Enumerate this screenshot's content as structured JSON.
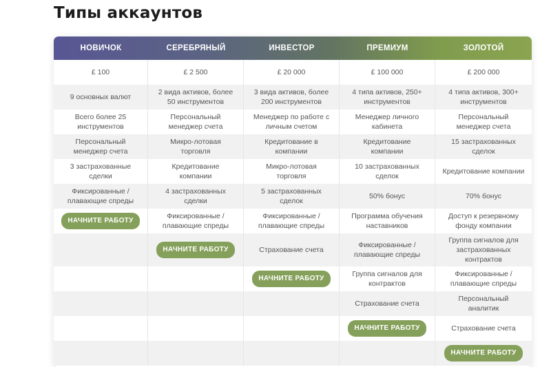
{
  "page": {
    "title": "Типы аккаунтов"
  },
  "columns": [
    "НОВИЧОК",
    "СЕРЕБРЯНЫЙ",
    "ИНВЕСТОР",
    "ПРЕМИУМ",
    "ЗОЛОТОЙ"
  ],
  "cta_label": "НАЧНИТЕ РАБОТУ",
  "rows": [
    [
      "£ 100",
      "£ 2 500",
      "£ 20 000",
      "£ 100 000",
      "£ 200 000"
    ],
    [
      "9 основных валют",
      "2 вида активов, более 50 инструментов",
      "3 вида активов, более 200 инструментов",
      "4 типа активов, 250+ инструментов",
      "4 типа активов, 300+ инструментов"
    ],
    [
      "Всего более 25 инструментов",
      "Персональный менеджер счета",
      "Менеджер по работе с личным счетом",
      "Менеджер личного кабинета",
      "Персональный менеджер счета"
    ],
    [
      "Персональный менеджер счета",
      "Микро-лотовая торговля",
      "Кредитование в компании",
      "Кредитование компании",
      "15 застрахованных сделок"
    ],
    [
      "3 застрахованные сделки",
      "Кредитование компании",
      "Микро-лотовая торговля",
      "10 застрахованных сделок",
      "Кредитование компании"
    ],
    [
      "Фиксированные / плавающие спреды",
      "4 застрахованных сделки",
      "5 застрахованных сделок",
      "50% бонус",
      "70% бонус"
    ],
    [
      "__CTA__",
      "Фиксированные / плавающие спреды",
      "Фиксированные / плавающие спреды",
      "Программа обучения наставников",
      "Доступ к резервному фонду компании"
    ],
    [
      "",
      "__CTA__",
      "Страхование счета",
      "Фиксированные / плавающие спреды",
      "Группа сигналов для застрахованных контрактов"
    ],
    [
      "",
      "",
      "__CTA__",
      "Группа сигналов для контрактов",
      "Фиксированные / плавающие спреды"
    ],
    [
      "",
      "",
      "",
      "Страхование счета",
      "Персональный аналитик"
    ],
    [
      "",
      "",
      "",
      "__CTA__",
      "Страхование счета"
    ],
    [
      "",
      "",
      "",
      "",
      "__CTA__"
    ]
  ]
}
